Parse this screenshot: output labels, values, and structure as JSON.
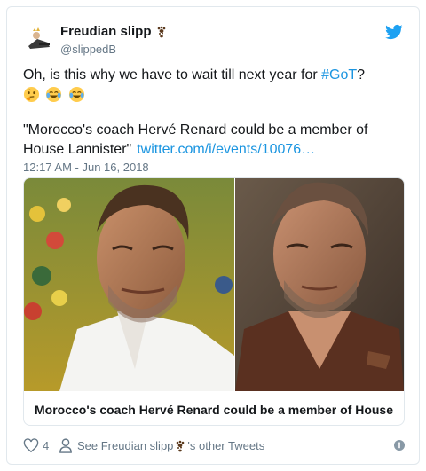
{
  "user": {
    "display_name": "Freudian slipp",
    "handle": "@slippedB"
  },
  "tweet": {
    "text_before_hashtag": "Oh, is this why we have to wait till next year for ",
    "hashtag": "#GoT",
    "text_after_hashtag": "?",
    "emojis": [
      "thinking-face-emoji",
      "joy-emoji",
      "joy-emoji"
    ],
    "quote_text": "\"Morocco's coach Hervé Renard could be a member of House Lannister\"",
    "quote_link": "twitter.com/i/events/10076…",
    "timestamp": "12:17 AM - Jun 16, 2018"
  },
  "media_card": {
    "title": "Morocco's coach Hervé Renard could be a member of House Lan…"
  },
  "footer": {
    "like_count": "4",
    "other_tweets_prefix": "See Freudian slipp",
    "other_tweets_suffix": "'s other Tweets"
  },
  "colors": {
    "link": "#1b95e0",
    "secondary_text": "#657786",
    "border": "#e1e8ed"
  }
}
